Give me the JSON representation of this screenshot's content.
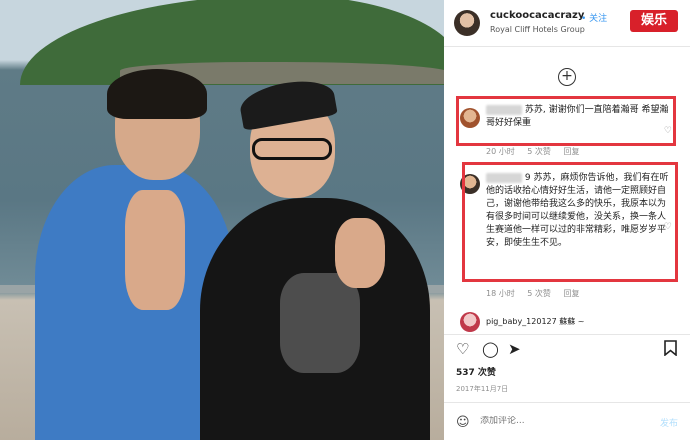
{
  "post": {
    "username": "cuckoocacacrazy",
    "verified_label": "• 关注",
    "location": "Royal Cliff Hotels Group",
    "brand_logo": "娱乐"
  },
  "comments": [
    {
      "text": "苏苏, 谢谢你们一直陪着瀚哥 希望瀚哥好好保重",
      "time": "20 小时",
      "likes": "5 次赞",
      "reply": "回复"
    },
    {
      "text": "9 苏苏，麻烦你告诉他，我们有在听他的话收拾心情好好生活，请他一定照顾好自己，谢谢他带给我这么多的快乐，我原本以为有很多时间可以继续爱他，没关系，换一条人生赛道他一样可以过的非常精彩，唯愿岁岁平安，即使生生不见。",
      "time": "18 小时",
      "likes": "5 次赞",
      "reply": "回复"
    },
    {
      "text": "pig_baby_120127 蘇蘇 ~"
    }
  ],
  "actions": {
    "like_icon": "heart-icon",
    "comment_icon": "comment-icon",
    "share_icon": "share-icon",
    "save_icon": "bookmark-icon"
  },
  "likes_count": "537 次赞",
  "post_date": "2017年11月7日",
  "add_comment": {
    "placeholder": "添加评论...",
    "post_label": "发布"
  },
  "colors": {
    "highlight": "#e3363f",
    "brand": "#d8202a",
    "link": "#3897f0"
  }
}
